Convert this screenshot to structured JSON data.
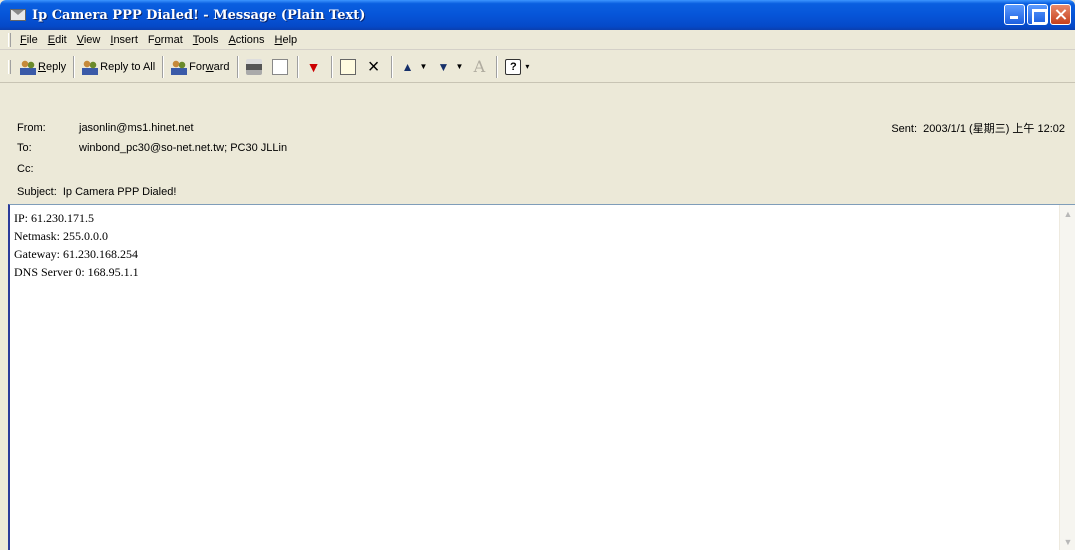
{
  "window": {
    "title": "Ip Camera PPP Dialed! - Message (Plain Text)"
  },
  "menu": {
    "items": [
      {
        "key": "F",
        "rest": "ile"
      },
      {
        "key": "E",
        "rest": "dit"
      },
      {
        "key": "V",
        "rest": "iew"
      },
      {
        "key": "I",
        "rest": "nsert"
      },
      {
        "pre": "F",
        "key": "o",
        "rest": "rmat"
      },
      {
        "key": "T",
        "rest": "ools"
      },
      {
        "key": "A",
        "rest": "ctions"
      },
      {
        "key": "H",
        "rest": "elp"
      }
    ]
  },
  "toolbar": {
    "reply_key": "R",
    "reply_rest": "eply",
    "reply_all_label": "Reply to All",
    "forward_pre": "For",
    "forward_key": "w",
    "forward_rest": "ard"
  },
  "header": {
    "from_label": "From:",
    "from_value": "jasonlin@ms1.hinet.net",
    "to_label": "To:",
    "to_value": "winbond_pc30@so-net.net.tw; PC30 JLLin",
    "cc_label": "Cc:",
    "cc_value": "",
    "subject_label": "Subject:",
    "subject_value": "Ip Camera PPP Dialed!",
    "sent_label": "Sent:",
    "sent_value": "2003/1/1 (星期三) 上午 12:02"
  },
  "body": {
    "lines": [
      "IP: 61.230.171.5",
      "Netmask: 255.0.0.0",
      "Gateway: 61.230.168.254",
      "DNS Server 0: 168.95.1.1"
    ]
  }
}
